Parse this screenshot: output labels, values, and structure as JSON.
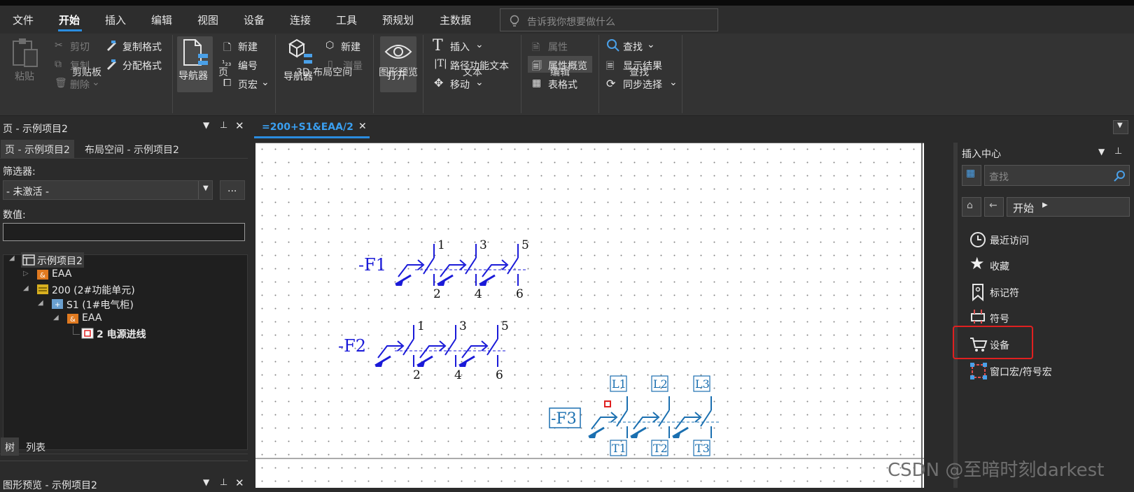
{
  "menu": [
    "文件",
    "开始",
    "插入",
    "编辑",
    "视图",
    "设备",
    "连接",
    "工具",
    "预规划",
    "主数据"
  ],
  "active_menu": "开始",
  "tellme_placeholder": "告诉我你想要做什么",
  "ribbon": {
    "clipboard": {
      "paste": "粘贴",
      "cut": "剪切",
      "copy": "复制",
      "delete": "删除",
      "copy_format": "复制格式",
      "assign_format": "分配格式",
      "group": "剪贴板"
    },
    "page": {
      "navigator": "导航器",
      "new": "新建",
      "number": "编号",
      "page_macro": "页宏",
      "group": "页"
    },
    "layout3d": {
      "navigator": "导航器",
      "new": "新建",
      "measure": "测量",
      "group": "3D 布局空间"
    },
    "preview": {
      "open": "打开",
      "group": "图形预览"
    },
    "text": {
      "insert": "插入",
      "path_text": "路径功能文本",
      "move": "移动",
      "group": "文本"
    },
    "edit": {
      "props": "属性",
      "props_overview": "属性概览",
      "table_format": "表格式",
      "group": "编辑"
    },
    "find": {
      "find": "查找",
      "show_results": "显示结果",
      "sync_select": "同步选择",
      "group": "查找"
    }
  },
  "left_panel": {
    "title": "页 - 示例项目2",
    "tab_pages": "页 - 示例项目2",
    "tab_layout": "布局空间 - 示例项目2",
    "filter_label": "筛选器:",
    "filter_value": "- 未激活 -",
    "more_btn": "...",
    "value_label": "数值:",
    "tree": [
      "示例项目2",
      "EAA",
      "200 (2#功能单元)",
      "S1 (1#电气柜)",
      "EAA",
      "2 电源进线"
    ],
    "bottom_tabs": [
      "树",
      "列表"
    ],
    "preview_title": "图形预览 - 示例项目2"
  },
  "doc_tab": "=200+S1&EAA/2",
  "schematic": {
    "f1": {
      "label": "-F1",
      "top": [
        "1",
        "3",
        "5"
      ],
      "bottom": [
        "2",
        "4",
        "6"
      ]
    },
    "f2": {
      "label": "-F2",
      "top": [
        "1",
        "3",
        "5"
      ],
      "bottom": [
        "2",
        "4",
        "6"
      ]
    },
    "f3": {
      "label": "-F3",
      "top": [
        "L1",
        "L2",
        "L3"
      ],
      "bottom": [
        "T1",
        "T2",
        "T3"
      ]
    }
  },
  "right_panel": {
    "title": "插入中心",
    "search_placeholder": "查找",
    "breadcrumb": "开始",
    "items": [
      "最近访问",
      "收藏",
      "标记符",
      "符号",
      "设备",
      "窗口宏/符号宏"
    ]
  },
  "watermark": "CSDN @至暗时刻darkest",
  "colors": {
    "accent": "#2a8de0",
    "highlight_box": "#e02020",
    "schematic_blue": "#1a1ad8",
    "device_blue": "#1a6fb0"
  }
}
